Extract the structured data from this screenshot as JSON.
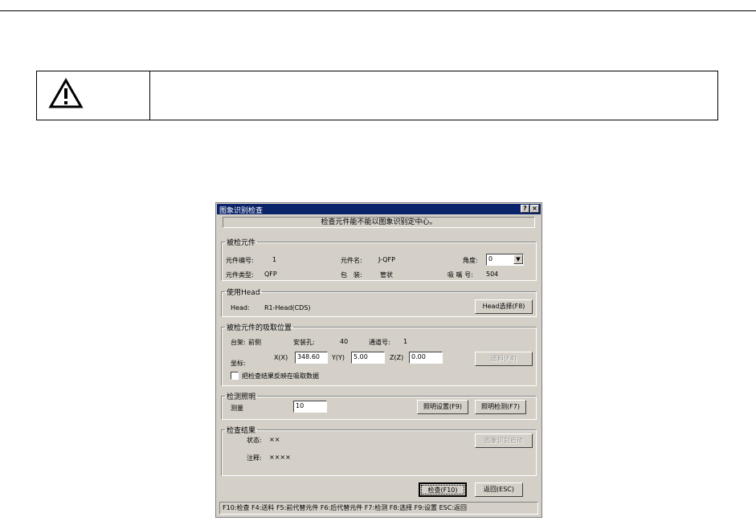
{
  "warning": {
    "icon": "warning-triangle-icon",
    "text": ""
  },
  "dialog": {
    "title": "图象识别检查",
    "help_btn": "?",
    "close_btn": "×",
    "message": "检查元件能不能以图象识别定中心。",
    "component": {
      "legend": "被检元件",
      "num_label": "元件编号:",
      "num_value": "1",
      "name_label": "元件名:",
      "name_value": "J-QFP",
      "angle_label": "角度:",
      "angle_value": "0",
      "type_label": "元件类型:",
      "type_value": "QFP",
      "package_label": "包　装:",
      "package_value": "管状",
      "nozzle_label": "吸 嘴 号:",
      "nozzle_value": "504"
    },
    "head": {
      "legend": "使用Head",
      "head_label": "Head:",
      "head_value": "R1-Head(CDS)",
      "select_btn": "Head选择(F8)"
    },
    "pickup": {
      "legend": "被检元件的吸取位置",
      "rack_label": "台架:",
      "rack_value": "前侧",
      "hole_label": "安装孔:",
      "hole_value": "40",
      "channel_label": "通道号:",
      "channel_value": "1",
      "coord_label": "坐标:",
      "x_label": "X(X)",
      "x_value": "348.60",
      "y_label": "Y(Y)",
      "y_value": "5.00",
      "z_label": "Z(Z)",
      "z_value": "0.00",
      "feed_btn": "送料(F4)",
      "reflect_label": "把检查结果反映在吸取数据"
    },
    "lighting": {
      "legend": "检测照明",
      "measure_label": "测量",
      "measure_value": "10",
      "setting_btn": "照明设置(F9)",
      "check_btn": "照明检测(F7)"
    },
    "result": {
      "legend": "检查结果",
      "status_label": "状态:",
      "status_value": "××",
      "note_label": "注释:",
      "note_value": "××××",
      "restart_btn": "图象识别启动"
    },
    "check_btn": "检查(F10)",
    "return_btn": "返回(ESC)",
    "statusbar": "F10:检查 F4:送料 F5:前代替元件 F6:后代替元件 F7:检测 F8:选择 F9:设置 ESC:返回"
  }
}
